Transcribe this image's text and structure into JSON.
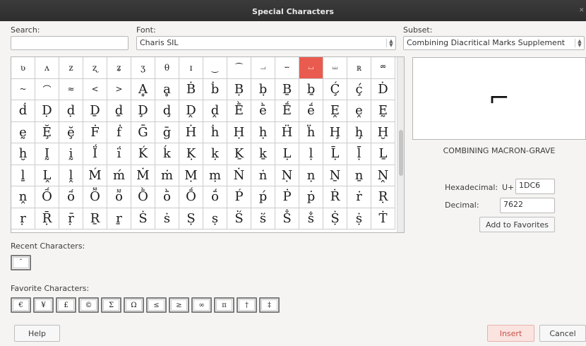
{
  "window": {
    "title": "Special Characters"
  },
  "search": {
    "label": "Search:",
    "value": ""
  },
  "font": {
    "label": "Font:",
    "value": "Charis SIL"
  },
  "subset": {
    "label": "Subset:",
    "value": "Combining Diacritical Marks Supplement"
  },
  "grid": {
    "cells": [
      "ʋ",
      "ʌ",
      "z",
      "ʐ",
      "ʑ",
      "ʒ",
      "θ",
      "ɪ",
      "‿",
      "⁀",
      "⏗",
      "⏖",
      "⏘",
      "⏙",
      "ʀ",
      "⏔",
      "~",
      "⌒",
      "≈",
      "<",
      ">",
      "Ḁ",
      "ḁ",
      "Ḃ",
      "ḃ",
      "Ḅ",
      "ḅ",
      "Ḇ",
      "ḇ",
      "Ḉ",
      "ḉ",
      "Ḋ",
      "ḋ",
      "Ḍ",
      "ḍ",
      "Ḏ",
      "ḏ",
      "Ḑ",
      "ḑ",
      "Ḓ",
      "ḓ",
      "Ḕ",
      "ḕ",
      "Ḗ",
      "ḗ",
      "Ḙ",
      "ḙ",
      "Ḛ",
      "ḛ",
      "Ḝ",
      "ḝ",
      "Ḟ",
      "ḟ",
      "Ḡ",
      "ḡ",
      "Ḣ",
      "ḣ",
      "Ḥ",
      "ḥ",
      "Ḧ",
      "ḧ",
      "Ḩ",
      "ḩ",
      "Ḫ",
      "ḫ",
      "Ḭ",
      "ḭ",
      "Ḯ",
      "ḯ",
      "Ḱ",
      "ḱ",
      "Ḳ",
      "ḳ",
      "Ḵ",
      "ḵ",
      "Ḷ",
      "ḷ",
      "Ḹ",
      "ḹ",
      "Ḻ",
      "ḻ",
      "Ḽ",
      "ḽ",
      "Ḿ",
      "ḿ",
      "Ṁ",
      "ṁ",
      "Ṃ",
      "ṃ",
      "Ṅ",
      "ṅ",
      "Ṇ",
      "ṇ",
      "Ṉ",
      "ṉ",
      "Ṋ",
      "ṋ",
      "Ṍ",
      "ṍ",
      "Ṏ",
      "ṏ",
      "Ṑ",
      "ṑ",
      "Ṓ",
      "ṓ",
      "Ṕ",
      "ṕ",
      "Ṗ",
      "ṗ",
      "Ṙ",
      "ṙ",
      "Ṛ",
      "ṛ",
      "Ṝ",
      "ṝ",
      "Ṟ",
      "ṟ",
      "Ṡ",
      "ṡ",
      "Ṣ",
      "ṣ",
      "Ṥ",
      "ṥ",
      "Ṧ",
      "ṧ",
      "Ṩ",
      "ṩ",
      "Ṫ"
    ],
    "selected_index": 12
  },
  "preview": {
    "glyph": "⌐",
    "name": "COMBINING MACRON-GRAVE"
  },
  "hex": {
    "label": "Hexadecimal:",
    "prefix": "U+",
    "value": "1DC6"
  },
  "dec": {
    "label": "Decimal:",
    "value": "7622"
  },
  "buttons": {
    "add_favorites": "Add to Favorites",
    "help": "Help",
    "insert": "Insert",
    "cancel": "Cancel"
  },
  "recent": {
    "label": "Recent Characters:",
    "items": [
      "˘"
    ]
  },
  "favorites": {
    "label": "Favorite Characters:",
    "items": [
      "€",
      "¥",
      "£",
      "©",
      "Σ",
      "Ω",
      "≤",
      "≥",
      "∞",
      "π",
      "†",
      "‡"
    ]
  },
  "icons": {
    "spin": "spin-updown-icon",
    "close": "close-icon"
  }
}
